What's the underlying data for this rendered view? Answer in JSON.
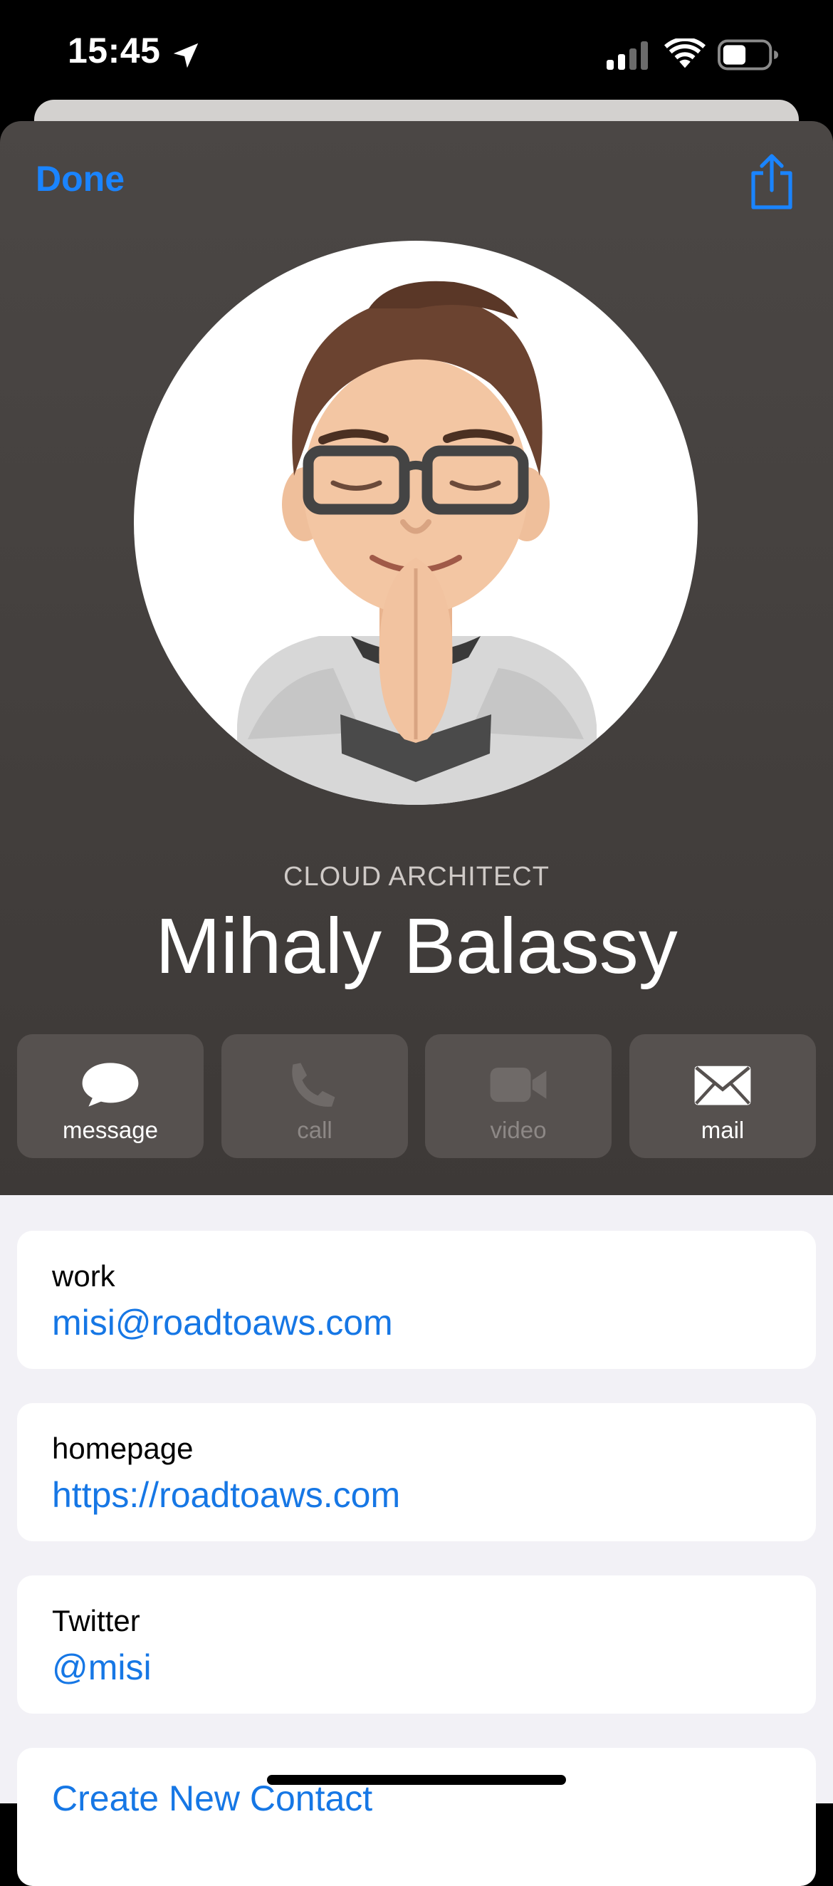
{
  "status_bar": {
    "time": "15:45"
  },
  "header": {
    "done_label": "Done",
    "job_title": "CLOUD ARCHITECT",
    "name": "Mihaly Balassy"
  },
  "actions": [
    {
      "label": "message",
      "icon": "message-bubble-icon",
      "enabled": true
    },
    {
      "label": "call",
      "icon": "phone-icon",
      "enabled": false
    },
    {
      "label": "video",
      "icon": "video-camera-icon",
      "enabled": false
    },
    {
      "label": "mail",
      "icon": "envelope-icon",
      "enabled": true
    }
  ],
  "fields": [
    {
      "label": "work",
      "value": "misi@roadtoaws.com"
    },
    {
      "label": "homepage",
      "value": "https://roadtoaws.com"
    },
    {
      "label": "Twitter",
      "value": "@misi"
    }
  ],
  "create_contact_label": "Create New Contact",
  "colors": {
    "accent": "#1a84ff",
    "link": "#1677e5",
    "header_bg": "#4b4745",
    "content_bg": "#f2f1f6"
  }
}
